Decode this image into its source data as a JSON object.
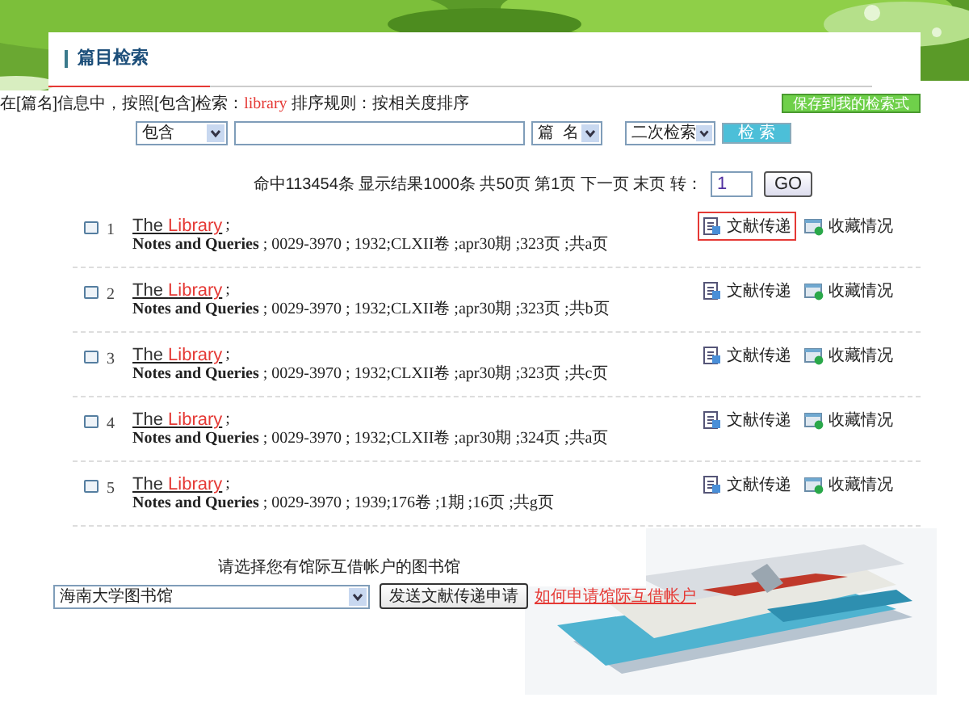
{
  "header": {
    "title": "篇目检索"
  },
  "query": {
    "prefix": "在[篇名]信息中，按照[包含]检索：",
    "term": "library",
    "rule": " 排序规则：按相关度排序"
  },
  "save_button": "保存到我的检索式",
  "search": {
    "match": "包含",
    "field": "篇  名",
    "mode": "二次检索",
    "button": "检 索"
  },
  "paging": {
    "text": "命中113454条 显示结果1000条 共50页 第1页 下一页 末页 转：",
    "page": "1",
    "go": "GO"
  },
  "results": [
    {
      "number": "1",
      "checked": false,
      "title": [
        {
          "text": "The ",
          "hit": false
        },
        {
          "text": "Library",
          "hit": true
        }
      ],
      "sep": ";",
      "source": "Notes and Queries",
      "details": " ; 0029-3970 ; 1932;CLXII卷 ;apr30期 ;323页 ;共a页",
      "actions": [
        {
          "label": "文献传递",
          "kind": "delivery",
          "highlighted": true
        },
        {
          "label": "收藏情况",
          "kind": "holdings",
          "highlighted": false
        }
      ]
    },
    {
      "number": "2",
      "checked": false,
      "title": [
        {
          "text": "The ",
          "hit": false
        },
        {
          "text": "Library",
          "hit": true
        }
      ],
      "sep": ";",
      "source": "Notes and Queries",
      "details": " ; 0029-3970 ; 1932;CLXII卷 ;apr30期 ;323页 ;共b页",
      "actions": [
        {
          "label": "文献传递",
          "kind": "delivery",
          "highlighted": false
        },
        {
          "label": "收藏情况",
          "kind": "holdings",
          "highlighted": false
        }
      ]
    },
    {
      "number": "3",
      "checked": false,
      "title": [
        {
          "text": "The ",
          "hit": false
        },
        {
          "text": "Library",
          "hit": true
        }
      ],
      "sep": ";",
      "source": "Notes and Queries",
      "details": " ; 0029-3970 ; 1932;CLXII卷 ;apr30期 ;323页 ;共c页",
      "actions": [
        {
          "label": "文献传递",
          "kind": "delivery",
          "highlighted": false
        },
        {
          "label": "收藏情况",
          "kind": "holdings",
          "highlighted": false
        }
      ]
    },
    {
      "number": "4",
      "checked": false,
      "title": [
        {
          "text": "The ",
          "hit": false
        },
        {
          "text": "Library",
          "hit": true
        }
      ],
      "sep": ";",
      "source": "Notes and Queries",
      "details": " ; 0029-3970 ; 1932;CLXII卷 ;apr30期 ;324页 ;共a页",
      "actions": [
        {
          "label": "文献传递",
          "kind": "delivery",
          "highlighted": false
        },
        {
          "label": "收藏情况",
          "kind": "holdings",
          "highlighted": false
        }
      ]
    },
    {
      "number": "5",
      "checked": false,
      "title": [
        {
          "text": "The ",
          "hit": false
        },
        {
          "text": "Library",
          "hit": true
        }
      ],
      "sep": ";",
      "source": "Notes and Queries",
      "details": " ; 0029-3970 ; 1939;176卷 ;1期 ;16页 ;共g页",
      "actions": [
        {
          "label": "文献传递",
          "kind": "delivery",
          "highlighted": false
        },
        {
          "label": "收藏情况",
          "kind": "holdings",
          "highlighted": false
        }
      ]
    }
  ],
  "request": {
    "label": "请选择您有馆际互借帐户的图书馆",
    "library": "海南大学图书馆",
    "button": "发送文献传递申请",
    "link": "如何申请馆际互借帐户"
  }
}
